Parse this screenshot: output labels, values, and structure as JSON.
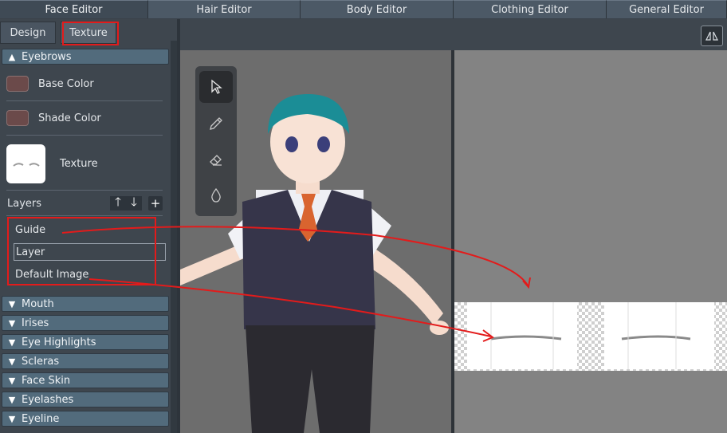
{
  "top_tabs": {
    "face": "Face Editor",
    "hair": "Hair Editor",
    "body": "Body Editor",
    "clothing": "Clothing Editor",
    "general": "General Editor"
  },
  "sub_tabs": {
    "design": "Design",
    "texture": "Texture"
  },
  "sections": {
    "eyebrows": "Eyebrows",
    "mouth": "Mouth",
    "irises": "Irises",
    "eye_highlights": "Eye Highlights",
    "scleras": "Scleras",
    "face_skin": "Face Skin",
    "eyelashes": "Eyelashes",
    "eyeline": "Eyeline"
  },
  "eyebrows": {
    "base_color_label": "Base Color",
    "shade_color_label": "Shade Color",
    "texture_label": "Texture",
    "layers_label": "Layers",
    "layers": [
      "Guide",
      "Layer",
      "Default Image"
    ],
    "base_color": "#6b4a4a",
    "shade_color": "#6a4848"
  },
  "symmetry_icon": "symmetry-mirror-icon",
  "tools": [
    "select-arrow-icon",
    "pencil-icon",
    "eraser-icon",
    "fill-drop-icon"
  ],
  "colors": {
    "annotation": "#e31b1b",
    "section_header": "#526b7c"
  }
}
